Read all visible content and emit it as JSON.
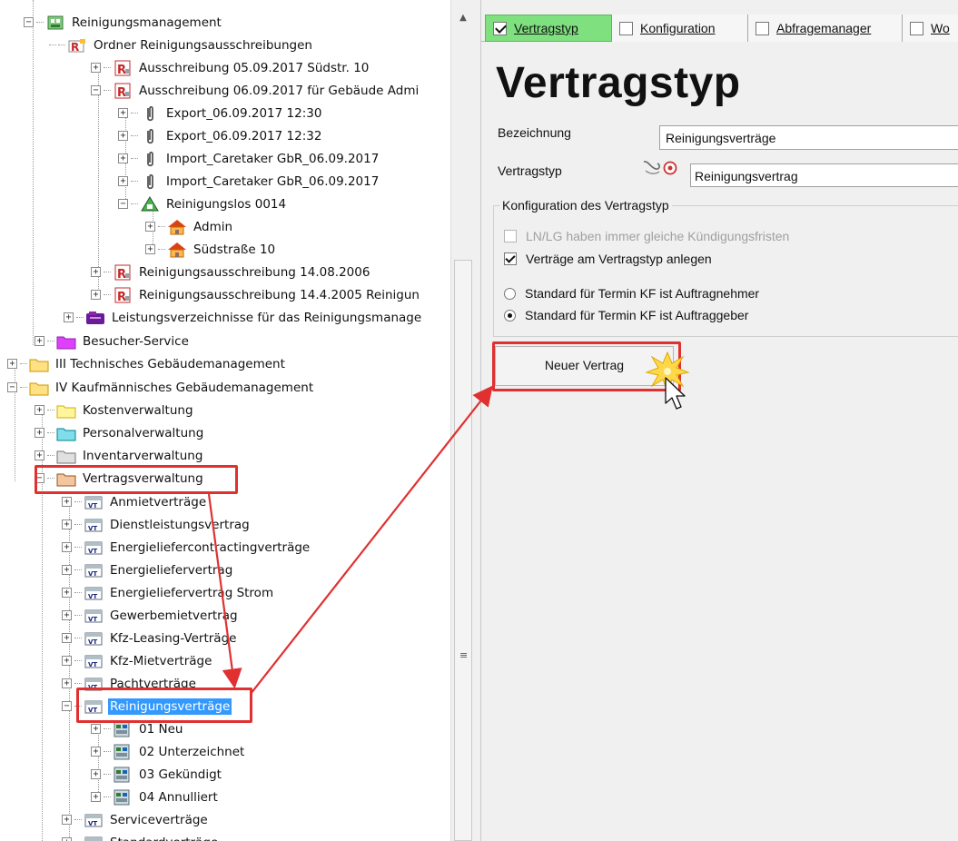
{
  "tree": {
    "items": [
      {
        "label": "Reinigungsmanagement",
        "icon": "cleaning-management-icon",
        "expander": "-"
      },
      {
        "label": "Ordner Reinigungsausschreibungen",
        "icon": "tender-folder-icon",
        "expander": ""
      },
      {
        "label": "Ausschreibung 05.09.2017 Südstr. 10",
        "icon": "tender-icon",
        "expander": "+"
      },
      {
        "label": "Ausschreibung 06.09.2017 für Gebäude Admi",
        "icon": "tender-icon",
        "expander": "-"
      },
      {
        "label": "Export_06.09.2017 12:30",
        "icon": "paperclip-icon",
        "expander": "+"
      },
      {
        "label": "Export_06.09.2017 12:32",
        "icon": "paperclip-icon",
        "expander": "+"
      },
      {
        "label": "Import_Caretaker GbR_06.09.2017",
        "icon": "paperclip-icon",
        "expander": "+"
      },
      {
        "label": "Import_Caretaker GbR_06.09.2017",
        "icon": "paperclip-icon",
        "expander": "+"
      },
      {
        "label": "Reinigungslos 0014",
        "icon": "cleaning-lot-icon",
        "expander": "-"
      },
      {
        "label": "Admin",
        "icon": "building-icon",
        "expander": "+"
      },
      {
        "label": "Südstraße 10",
        "icon": "building-icon",
        "expander": "+"
      },
      {
        "label": "Reinigungsausschreibung 14.08.2006",
        "icon": "tender-icon",
        "expander": "+"
      },
      {
        "label": "Reinigungsausschreibung 14.4.2005 Reinigun",
        "icon": "tender-icon",
        "expander": "+"
      },
      {
        "label": "Leistungsverzeichnisse für das Reinigungsmanage",
        "icon": "service-catalog-icon",
        "expander": "+"
      },
      {
        "label": "Besucher-Service",
        "icon": "pink-folder-icon",
        "expander": "+"
      },
      {
        "label": "III Technisches Gebäudemanagement",
        "icon": "yellow-folder-icon",
        "expander": "+"
      },
      {
        "label": "IV Kaufmännisches Gebäudemanagement",
        "icon": "yellow-folder-icon",
        "expander": "-"
      },
      {
        "label": "Kostenverwaltung",
        "icon": "light-yellow-folder-icon",
        "expander": "+"
      },
      {
        "label": "Personalverwaltung",
        "icon": "cyan-folder-icon",
        "expander": "+"
      },
      {
        "label": "Inventarverwaltung",
        "icon": "grey-folder-icon",
        "expander": "+"
      },
      {
        "label": "Vertragsverwaltung",
        "icon": "brown-folder-icon",
        "expander": "-"
      },
      {
        "label": "Anmietverträge",
        "icon": "contract-type-icon",
        "expander": "+"
      },
      {
        "label": "Dienstleistungsvertrag",
        "icon": "contract-type-icon",
        "expander": "+"
      },
      {
        "label": "Energieliefercontractingverträge",
        "icon": "contract-type-icon",
        "expander": "+"
      },
      {
        "label": "Energieliefervertrag",
        "icon": "contract-type-icon",
        "expander": "+"
      },
      {
        "label": "Energieliefervertrag Strom",
        "icon": "contract-type-icon",
        "expander": "+"
      },
      {
        "label": "Gewerbemietvertrag",
        "icon": "contract-type-icon",
        "expander": "+"
      },
      {
        "label": "Kfz-Leasing-Verträge",
        "icon": "contract-type-icon",
        "expander": "+"
      },
      {
        "label": "Kfz-Mietverträge",
        "icon": "contract-type-icon",
        "expander": "+"
      },
      {
        "label": "Pachtverträge",
        "icon": "contract-type-icon",
        "expander": "+"
      },
      {
        "label": "Reinigungsverträge",
        "icon": "contract-type-icon",
        "expander": "-"
      },
      {
        "label": "01 Neu",
        "icon": "status-list-icon",
        "expander": "+"
      },
      {
        "label": "02 Unterzeichnet",
        "icon": "status-list-icon",
        "expander": "+"
      },
      {
        "label": "03 Gekündigt",
        "icon": "status-list-icon",
        "expander": "+"
      },
      {
        "label": "04 Annulliert",
        "icon": "status-list-icon",
        "expander": "+"
      },
      {
        "label": "Serviceverträge",
        "icon": "contract-type-icon",
        "expander": "+"
      },
      {
        "label": "Standardverträge",
        "icon": "contract-type-icon",
        "expander": "+"
      }
    ],
    "selected_label": "Reinigungsverträge"
  },
  "tabs": [
    {
      "label": "Vertragstyp",
      "checked": true,
      "active": true
    },
    {
      "label": "Konfiguration",
      "checked": false,
      "active": false
    },
    {
      "label": "Abfragemanager",
      "checked": false,
      "active": false
    },
    {
      "label": "Wo",
      "checked": false,
      "active": false
    }
  ],
  "form": {
    "heading": "Vertragstyp",
    "bezeichnung_label": "Bezeichnung",
    "bezeichnung_value": "Reinigungsverträge",
    "vertragstyp_label": "Vertragstyp",
    "vertragstyp_value": "Reinigungsvertrag",
    "group_title": "Konfiguration des Vertragstyp",
    "option_lnlg": "LN/LG haben immer gleiche Kündigungsfristen",
    "option_vertraege": "Verträge am Vertragstyp anlegen",
    "radio_auftragnehmer": "Standard für Termin KF ist Auftragnehmer",
    "radio_auftraggeber": "Standard für Termin KF ist Auftraggeber",
    "new_contract_button": "Neuer Vertrag"
  },
  "colors": {
    "highlight": "#e03030",
    "active_tab": "#7fe07f",
    "selection": "#3399ff"
  }
}
